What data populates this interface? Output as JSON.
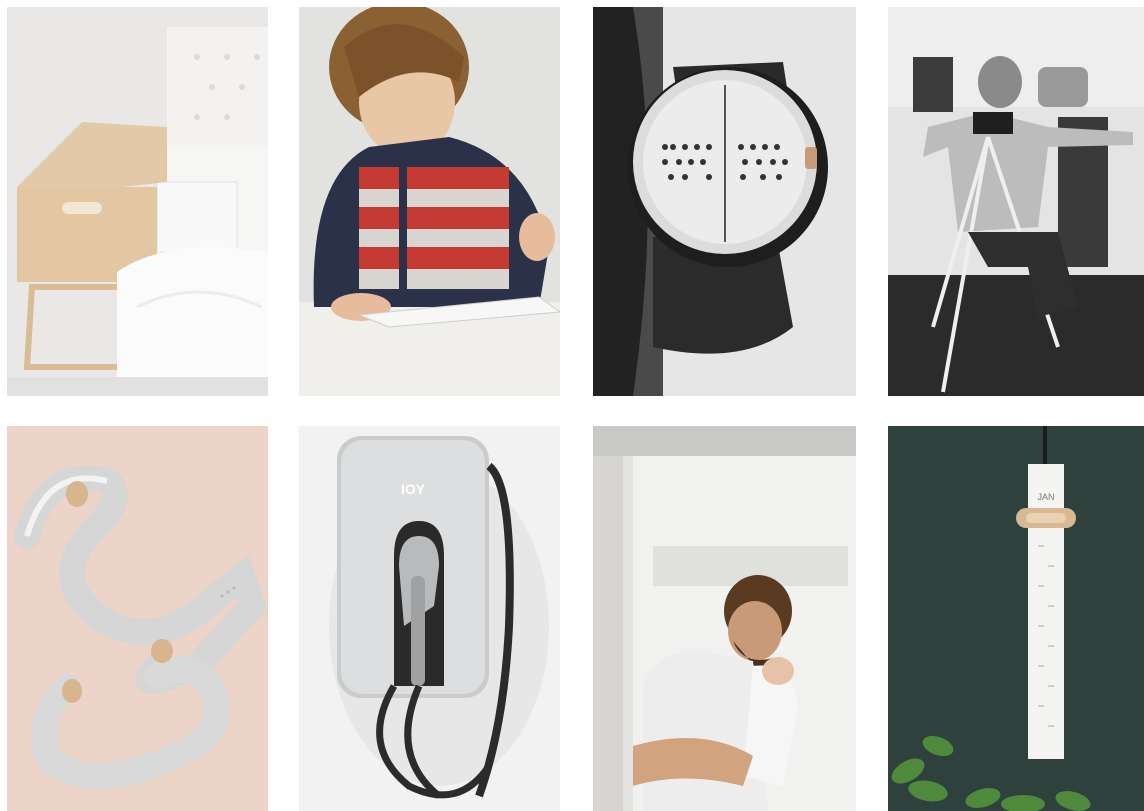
{
  "gallery": {
    "images": [
      {
        "subject": "bassinet"
      },
      {
        "subject": "child-with-tablet"
      },
      {
        "subject": "braille-smartwatch"
      },
      {
        "subject": "man-with-tripod"
      },
      {
        "subject": "ribbon-hook-sculpture"
      },
      {
        "subject": "ev-wall-charger"
      },
      {
        "subject": "father-holding-baby"
      },
      {
        "subject": "wall-calendar-strip"
      }
    ],
    "charger_logo": "IOY",
    "calendar_month": "JAN"
  },
  "colors": {
    "page_bg": "#ffffff",
    "blush": "#ecd5c8",
    "dark_green": "#2e413c",
    "wood": "#d9b894"
  }
}
